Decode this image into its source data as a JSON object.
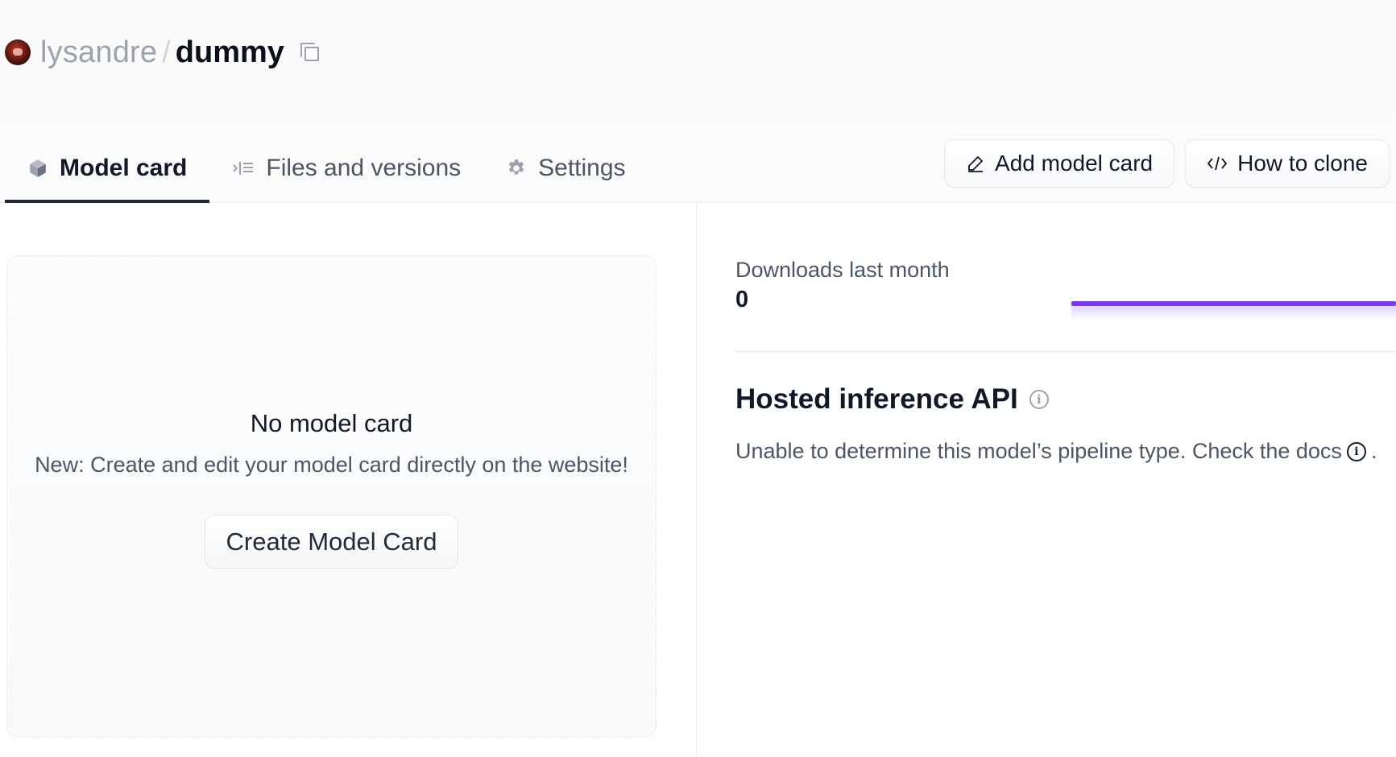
{
  "repo": {
    "owner": "lysandre",
    "separator": "/",
    "name": "dummy"
  },
  "tabs": [
    {
      "label": "Model card",
      "icon": "cube-icon",
      "active": true
    },
    {
      "label": "Files and versions",
      "icon": "files-icon",
      "active": false
    },
    {
      "label": "Settings",
      "icon": "gear-icon",
      "active": false
    }
  ],
  "actions": {
    "add_model_card": "Add model card",
    "how_to_clone": "How to clone"
  },
  "model_card": {
    "title": "No model card",
    "subtitle": "New: Create and edit your model card directly on the website!",
    "create_button": "Create Model Card"
  },
  "downloads": {
    "label": "Downloads last month",
    "value": "0"
  },
  "inference": {
    "title": "Hosted inference API",
    "message": "Unable to determine this model’s pipeline type. Check the docs",
    "suffix": "."
  },
  "colors": {
    "sparkline": "#7c3aed",
    "active_tab_underline": "#1f2937"
  }
}
